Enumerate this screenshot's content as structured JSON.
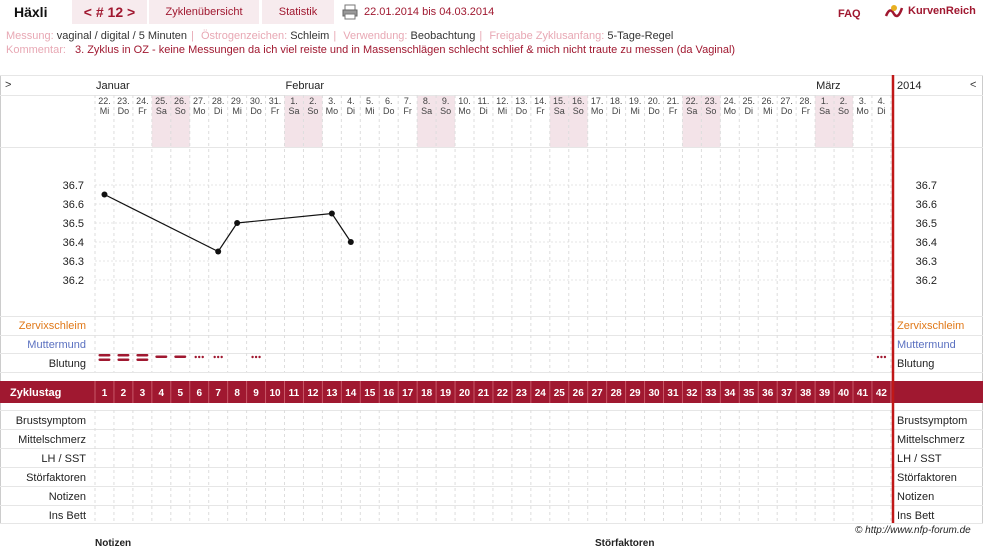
{
  "header": {
    "name": "Häxli",
    "cycle": "< # 12 >",
    "tab_overview": "Zyklenübersicht",
    "tab_stats": "Statistik",
    "date_range": "22.01.2014 bis 04.03.2014",
    "faq": "FAQ",
    "logo_text": "KurvenReich"
  },
  "meta": {
    "messung_label": "Messung:",
    "messung_value": "vaginal / digital / 5 Minuten",
    "oestrogen_label": "Östrogenzeichen:",
    "oestrogen_value": "Schleim",
    "verwendung_label": "Verwendung:",
    "verwendung_value": "Beobachtung",
    "freigabe_label": "Freigabe Zyklusanfang:",
    "freigabe_value": "5-Tage-Regel",
    "kommentar_label": "Kommentar:",
    "kommentar_value": "3. Zyklus in OZ - keine Messungen da ich viel reiste und in Massenschlägen schlecht schlief & mich nicht traute zu messen (da Vaginal)"
  },
  "chart_data": {
    "type": "line",
    "title": "",
    "nav_left": ">",
    "nav_right": "<",
    "year": "2014",
    "months": [
      {
        "label": "Januar",
        "start_index": 0
      },
      {
        "label": "Februar",
        "start_index": 10
      },
      {
        "label": "März",
        "start_index": 38
      }
    ],
    "days": [
      {
        "d": "22.",
        "w": "Mi"
      },
      {
        "d": "23.",
        "w": "Do"
      },
      {
        "d": "24.",
        "w": "Fr"
      },
      {
        "d": "25.",
        "w": "Sa"
      },
      {
        "d": "26.",
        "w": "So"
      },
      {
        "d": "27.",
        "w": "Mo"
      },
      {
        "d": "28.",
        "w": "Di"
      },
      {
        "d": "29.",
        "w": "Mi"
      },
      {
        "d": "30.",
        "w": "Do"
      },
      {
        "d": "31.",
        "w": "Fr"
      },
      {
        "d": "1.",
        "w": "Sa"
      },
      {
        "d": "2.",
        "w": "So"
      },
      {
        "d": "3.",
        "w": "Mo"
      },
      {
        "d": "4.",
        "w": "Di"
      },
      {
        "d": "5.",
        "w": "Mi"
      },
      {
        "d": "6.",
        "w": "Do"
      },
      {
        "d": "7.",
        "w": "Fr"
      },
      {
        "d": "8.",
        "w": "Sa"
      },
      {
        "d": "9.",
        "w": "So"
      },
      {
        "d": "10.",
        "w": "Mo"
      },
      {
        "d": "11.",
        "w": "Di"
      },
      {
        "d": "12.",
        "w": "Mi"
      },
      {
        "d": "13.",
        "w": "Do"
      },
      {
        "d": "14.",
        "w": "Fr"
      },
      {
        "d": "15.",
        "w": "Sa"
      },
      {
        "d": "16.",
        "w": "So"
      },
      {
        "d": "17.",
        "w": "Mo"
      },
      {
        "d": "18.",
        "w": "Di"
      },
      {
        "d": "19.",
        "w": "Mi"
      },
      {
        "d": "20.",
        "w": "Do"
      },
      {
        "d": "21.",
        "w": "Fr"
      },
      {
        "d": "22.",
        "w": "Sa"
      },
      {
        "d": "23.",
        "w": "So"
      },
      {
        "d": "24.",
        "w": "Mo"
      },
      {
        "d": "25.",
        "w": "Di"
      },
      {
        "d": "26.",
        "w": "Mi"
      },
      {
        "d": "27.",
        "w": "Do"
      },
      {
        "d": "28.",
        "w": "Fr"
      },
      {
        "d": "1.",
        "w": "Sa"
      },
      {
        "d": "2.",
        "w": "So"
      },
      {
        "d": "3.",
        "w": "Mo"
      },
      {
        "d": "4.",
        "w": "Di"
      }
    ],
    "weekend_indices": [
      3,
      4,
      10,
      11,
      17,
      18,
      24,
      25,
      31,
      32,
      38,
      39
    ],
    "y_ticks": [
      "36.7",
      "36.6",
      "36.5",
      "36.4",
      "36.3",
      "36.2"
    ],
    "ylim": [
      36.2,
      36.7
    ],
    "series": [
      {
        "points": [
          [
            1,
            36.65
          ],
          [
            7,
            36.35
          ],
          [
            8,
            36.5
          ],
          [
            13,
            36.55
          ],
          [
            14,
            36.4
          ]
        ]
      }
    ],
    "rows_left": [
      "Zervixschleim",
      "Muttermund",
      "Blutung"
    ],
    "rows_right": [
      "Zervixschleim",
      "Muttermund",
      "Blutung"
    ],
    "bleeding": [
      {
        "day": 1,
        "type": "strong"
      },
      {
        "day": 2,
        "type": "strong"
      },
      {
        "day": 3,
        "type": "strong"
      },
      {
        "day": 4,
        "type": "medium"
      },
      {
        "day": 5,
        "type": "medium"
      },
      {
        "day": 6,
        "type": "spot"
      },
      {
        "day": 7,
        "type": "spot"
      },
      {
        "day": 9,
        "type": "spot"
      },
      {
        "day": 42,
        "type": "spot"
      }
    ],
    "cycle_day_label": "Zyklustag",
    "cycle_days": [
      "1",
      "2",
      "3",
      "4",
      "5",
      "6",
      "7",
      "8",
      "9",
      "10",
      "11",
      "12",
      "13",
      "14",
      "15",
      "16",
      "17",
      "18",
      "19",
      "20",
      "21",
      "22",
      "23",
      "24",
      "25",
      "26",
      "27",
      "28",
      "29",
      "30",
      "31",
      "32",
      "33",
      "34",
      "35",
      "36",
      "37",
      "38",
      "39",
      "40",
      "41",
      "42"
    ],
    "bottom_rows": [
      "Brustsymptom",
      "Mittelschmerz",
      "LH / SST",
      "Störfaktoren",
      "Notizen",
      "Ins Bett"
    ],
    "colors": {
      "accent": "#a01830",
      "weekend": "#f3e3e8",
      "cervix": "#e07818",
      "mouth": "#5a70c0",
      "today": "#c01818"
    }
  },
  "footer": {
    "copyright": "© http://www.nfp-forum.de",
    "notes": "Notizen",
    "disturb": "Störfaktoren"
  }
}
